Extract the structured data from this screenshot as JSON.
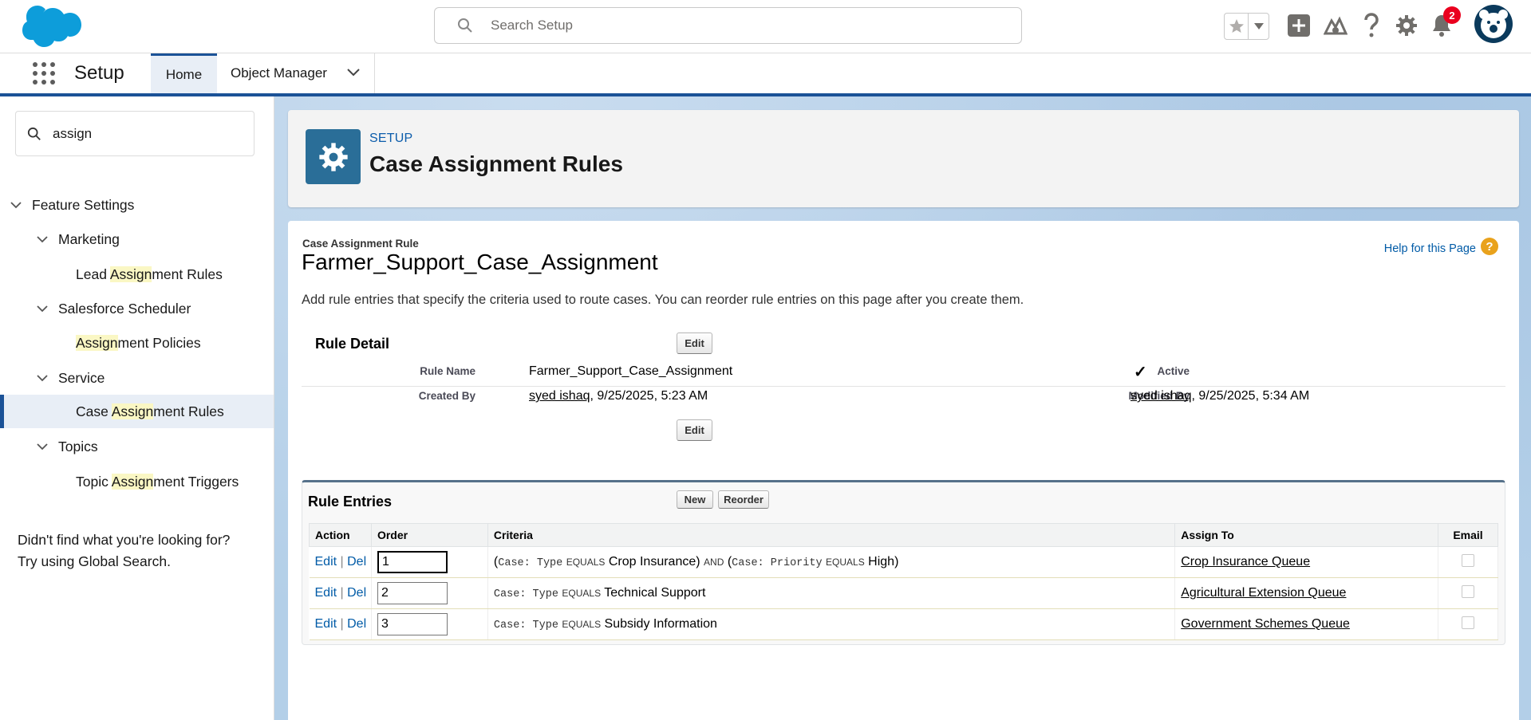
{
  "header": {
    "search_placeholder": "Search Setup",
    "notification_count": "2",
    "icons": [
      "favorites-star-icon",
      "chevron-down-icon",
      "add-icon",
      "trailhead-icon",
      "help-icon",
      "gear-icon",
      "bell-icon"
    ]
  },
  "context": {
    "app_name": "Setup",
    "tabs": [
      {
        "label": "Home",
        "active": true
      },
      {
        "label": "Object Manager",
        "active": false
      }
    ]
  },
  "sidebar": {
    "quickfind_value": "assign",
    "tree": [
      {
        "label": "Feature Settings",
        "level": 0
      },
      {
        "label": "Marketing",
        "level": 1
      },
      {
        "pre": "Lead ",
        "hl": "Assign",
        "post": "ment Rules",
        "level": 2
      },
      {
        "label": "Salesforce Scheduler",
        "level": 1
      },
      {
        "pre": "",
        "hl": "Assign",
        "post": "ment Policies",
        "level": 2
      },
      {
        "label": "Service",
        "level": 1
      },
      {
        "pre": "Case ",
        "hl": "Assign",
        "post": "ment Rules",
        "level": 2,
        "selected": true
      },
      {
        "label": "Topics",
        "level": 1
      },
      {
        "pre": "Topic ",
        "hl": "Assign",
        "post": "ment Triggers",
        "level": 2
      }
    ],
    "not_found_line1": "Didn't find what you're looking for?",
    "not_found_line2": "Try using Global Search."
  },
  "page_header": {
    "eyebrow": "SETUP",
    "title": "Case Assignment Rules"
  },
  "content": {
    "eyebrow": "Case Assignment Rule",
    "title": "Farmer_Support_Case_Assignment",
    "help_link": "Help for this Page",
    "help_glyph": "?",
    "description": "Add rule entries that specify the criteria used to route cases. You can reorder rule entries on this page after you create them.",
    "rule_detail": {
      "title": "Rule Detail",
      "edit_label": "Edit",
      "rule_name_label": "Rule Name",
      "rule_name": "Farmer_Support_Case_Assignment",
      "active_label": "Active",
      "active_check": "✓",
      "created_by_label": "Created By",
      "created_by_user": "syed ishaq",
      "created_by_date": ", 9/25/2025, 5:23 AM",
      "modified_by_label": "Modified By",
      "modified_by_user": "syed ishaq",
      "modified_by_date": ", 9/25/2025, 5:34 AM"
    },
    "rule_entries": {
      "title": "Rule Entries",
      "new_label": "New",
      "reorder_label": "Reorder",
      "columns": [
        "Action",
        "Order",
        "Criteria",
        "Assign To",
        "Email"
      ],
      "edit_text": "Edit",
      "sep": " | ",
      "del_text": "Del",
      "rows": [
        {
          "order": "1",
          "assign_to": "Crop Insurance Queue"
        },
        {
          "order": "2",
          "assign_to": "Agricultural Extension Queue"
        },
        {
          "order": "3",
          "assign_to": "Government Schemes Queue"
        }
      ],
      "criteria": {
        "paren_open": "(",
        "paren_close": ")",
        "and_kw": "AND",
        "case_type": "Case: Type",
        "case_priority": "Case: Priority",
        "equals_kw": "EQUALS",
        "row1_val1": "Crop Insurance",
        "row1_val2": "High",
        "row2_val": "Technical Support",
        "row3_val": "Subsidy Information"
      }
    }
  },
  "colors": {
    "brand_blue": "#1b5297",
    "link_blue": "#015ba7",
    "setup_tile": "#2a6e98",
    "badge_red": "#ea001e",
    "highlight": "#faf7c4"
  }
}
